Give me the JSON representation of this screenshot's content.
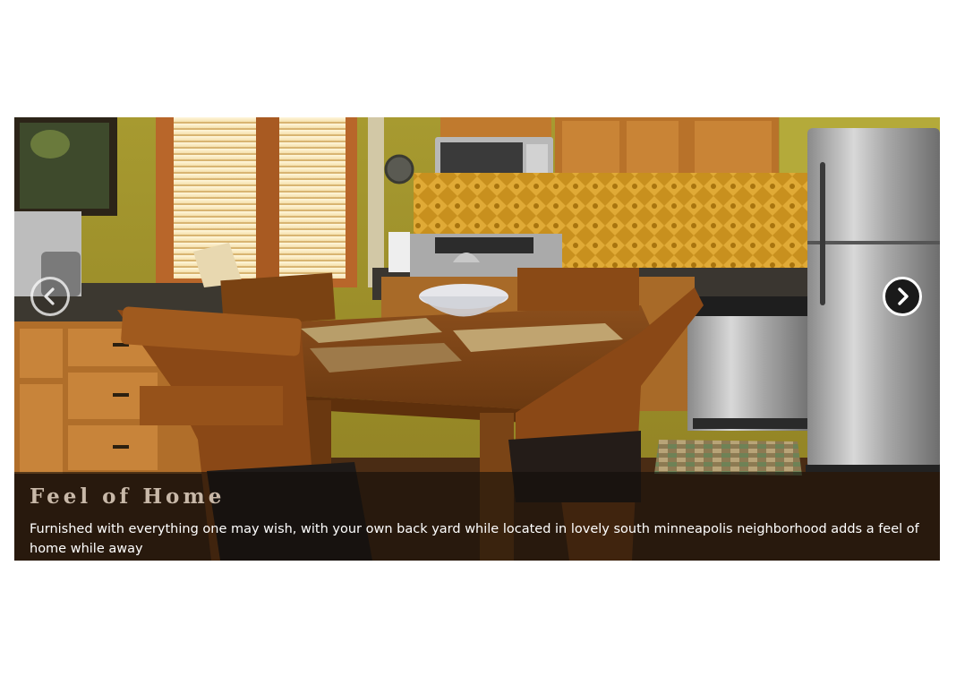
{
  "slider": {
    "image_alt": "Kitchen with wooden dining table and chairs",
    "prev_icon": "chevron-left-icon",
    "next_icon": "chevron-right-icon",
    "caption": {
      "title": "Feel of Home",
      "text": "Furnished with everything one may wish, with your own back yard while located in lovely south minneapolis neighborhood adds a feel of home while away"
    }
  }
}
